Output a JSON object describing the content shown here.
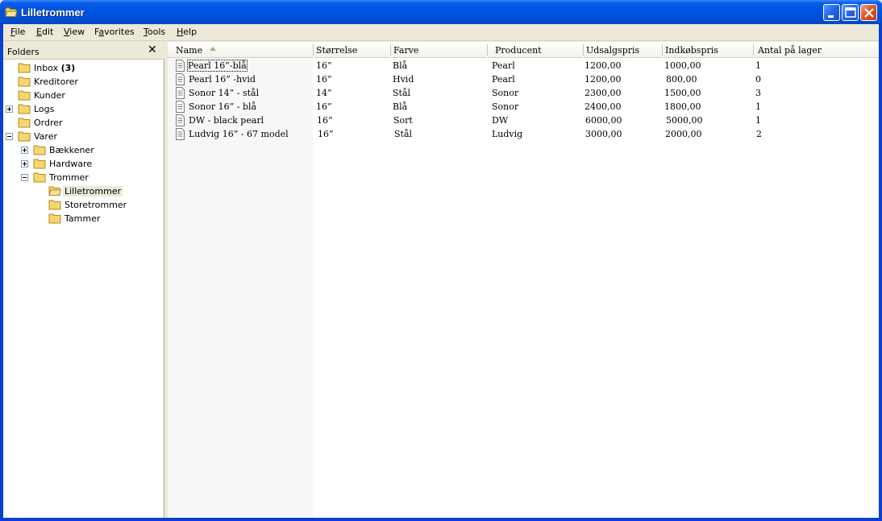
{
  "window": {
    "title": "Lilletrommer",
    "icon": "folder-open-icon",
    "accent": "#0054e3"
  },
  "menu": [
    {
      "pre": "",
      "u": "F",
      "post": "ile"
    },
    {
      "pre": "",
      "u": "E",
      "post": "dit"
    },
    {
      "pre": "",
      "u": "V",
      "post": "iew"
    },
    {
      "pre": "F",
      "u": "a",
      "post": "vorites"
    },
    {
      "pre": "",
      "u": "T",
      "post": "ools"
    },
    {
      "pre": "",
      "u": "H",
      "post": "elp"
    }
  ],
  "folders": {
    "header": "Folders",
    "close": "✕",
    "tree": [
      {
        "label": "Inbox",
        "count": "(3)"
      },
      {
        "label": "Kreditorer"
      },
      {
        "label": "Kunder"
      },
      {
        "label": "Logs"
      },
      {
        "label": "Ordrer"
      },
      {
        "label": "Varer"
      },
      {
        "label": "Bækkener"
      },
      {
        "label": "Hardware"
      },
      {
        "label": "Trommer"
      },
      {
        "label": "Lilletrommer"
      },
      {
        "label": "Storetrommer"
      },
      {
        "label": "Tammer"
      }
    ]
  },
  "list": {
    "columns": [
      "Name",
      "Størrelse",
      "Farve",
      "Producent",
      "Udsalgspris",
      "Indkøbspris",
      "Antal på lager"
    ],
    "rows": [
      {
        "name": "Pearl 16”-blå",
        "size": "16”",
        "color": "Blå",
        "maker": "Pearl",
        "price": "1200,00",
        "cost": "1000,00",
        "stock": "1"
      },
      {
        "name": "Pearl 16” -hvid",
        "size": "16”",
        "color": "Hvid",
        "maker": "Pearl",
        "price": "1200,00",
        "cost": "800,00",
        "stock": "0"
      },
      {
        "name": "Sonor 14” - stål",
        "size": "14”",
        "color": "Stål",
        "maker": "Sonor",
        "price": "2300,00",
        "cost": "1500,00",
        "stock": "3"
      },
      {
        "name": "Sonor 16” - blå",
        "size": "16”",
        "color": "Blå",
        "maker": "Sonor",
        "price": "2400,00",
        "cost": "1800,00",
        "stock": "1"
      },
      {
        "name": "DW - black pearl",
        "size": "16”",
        "color": "Sort",
        "maker": "DW",
        "price": "6000,00",
        "cost": "5000,00",
        "stock": "1"
      },
      {
        "name": "Ludvig 16” - 67 model",
        "size": "16”",
        "color": "Stål",
        "maker": "Ludvig",
        "price": "3000,00",
        "cost": "2000,00",
        "stock": "2"
      }
    ]
  }
}
